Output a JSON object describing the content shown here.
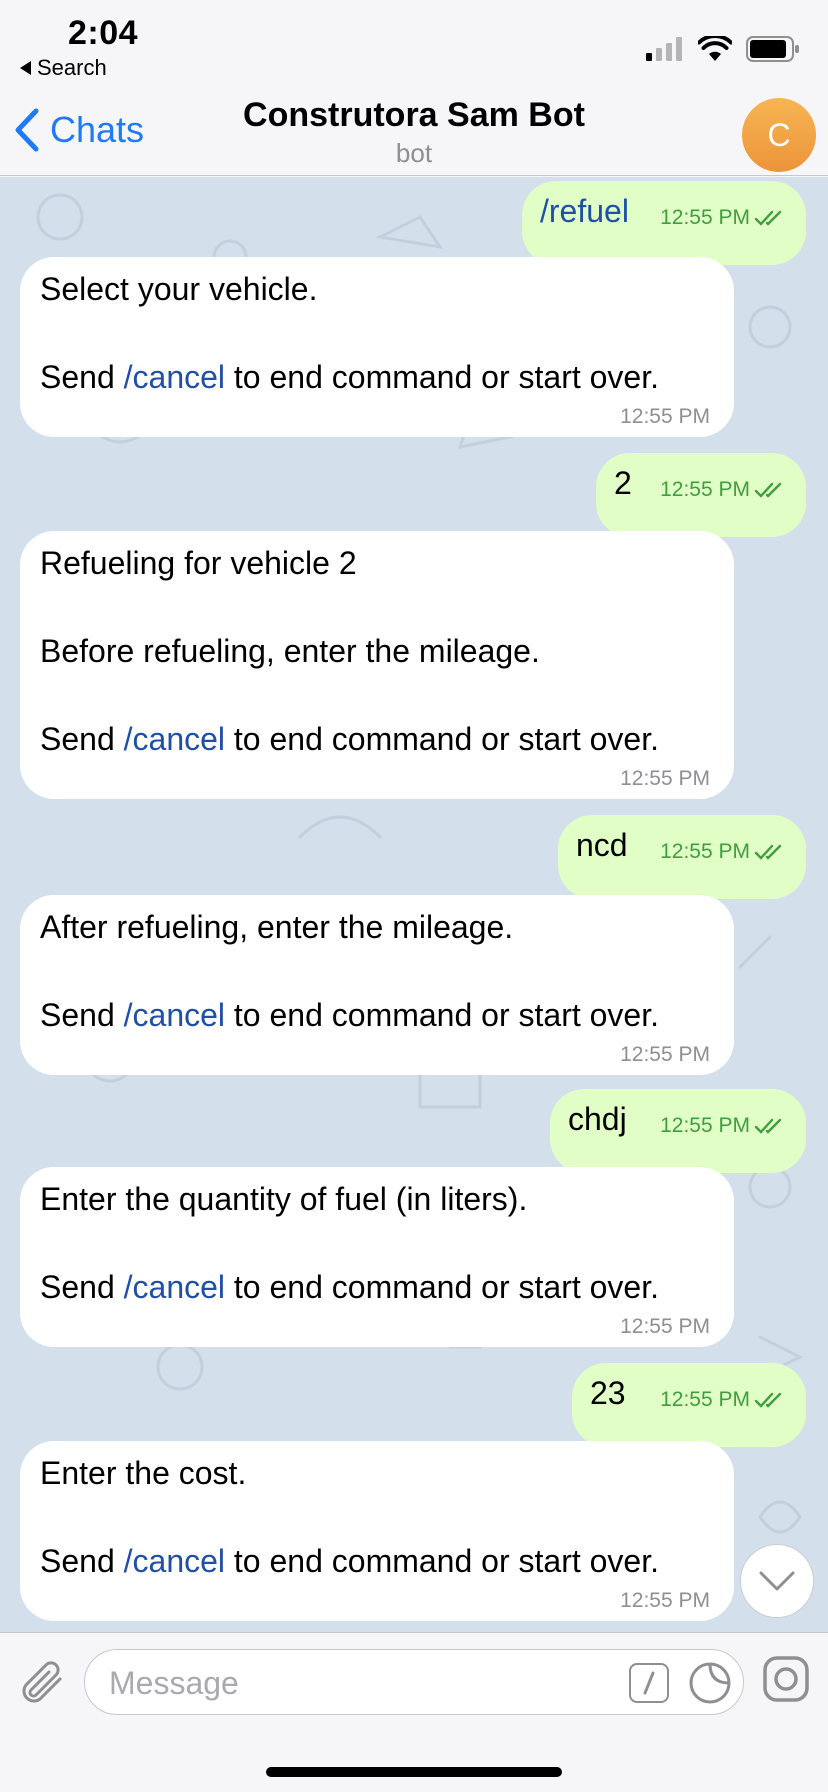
{
  "status_bar": {
    "time": "2:04",
    "back_app_label": "Search",
    "signal_icon": "cellular-signal-icon",
    "wifi_icon": "wifi-icon",
    "battery_icon": "battery-icon"
  },
  "header": {
    "back_label": "Chats",
    "title": "Construtora Sam Bot",
    "subtitle": "bot",
    "avatar_letter": "C",
    "avatar_color": "#f0a046",
    "accent_color": "#1e7bf5"
  },
  "messages": [
    {
      "from": "me",
      "text": "/refuel",
      "time": "12:55 PM"
    },
    {
      "from": "bot",
      "lines": [
        "Select your vehicle.",
        "",
        "Send /cancel to end command or start over."
      ],
      "time": "12:55 PM"
    },
    {
      "from": "me",
      "text": "2",
      "time": "12:55 PM"
    },
    {
      "from": "bot",
      "lines": [
        "Refueling for vehicle 2",
        "",
        "Before refueling, enter the mileage.",
        "",
        "Send /cancel to end command or start over."
      ],
      "time": "12:55 PM"
    },
    {
      "from": "me",
      "text": "ncd",
      "time": "12:55 PM"
    },
    {
      "from": "bot",
      "lines": [
        "After refueling, enter the mileage.",
        "",
        "Send /cancel to end command or start over."
      ],
      "time": "12:55 PM"
    },
    {
      "from": "me",
      "text": "chdj",
      "time": "12:55 PM"
    },
    {
      "from": "bot",
      "lines": [
        "Enter the quantity of fuel (in liters).",
        "",
        "Send /cancel to end command or start over."
      ],
      "time": "12:55 PM"
    },
    {
      "from": "me",
      "text": "23",
      "time": "12:55 PM"
    },
    {
      "from": "bot",
      "lines": [
        "Enter the cost.",
        "",
        "Send /cancel to end command or start over."
      ],
      "time": "12:55 PM"
    }
  ],
  "input": {
    "placeholder": "Message"
  }
}
